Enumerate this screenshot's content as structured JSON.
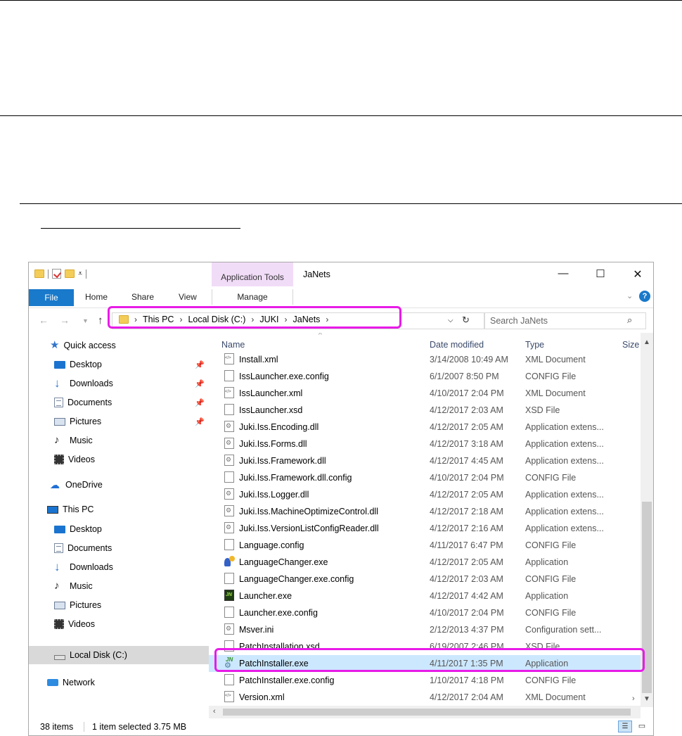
{
  "window": {
    "title": "JaNets",
    "context_tab": "Application Tools",
    "controls": {
      "minimize": "—",
      "maximize": "☐",
      "close": "✕"
    }
  },
  "ribbon": {
    "tabs": [
      "File",
      "Home",
      "Share",
      "View",
      "Manage"
    ],
    "collapse_glyph": "⌄",
    "help_glyph": "?"
  },
  "address": {
    "crumbs": [
      "This PC",
      "Local Disk (C:)",
      "JUKI",
      "JaNets"
    ],
    "separator": "›",
    "search_placeholder": "Search JaNets"
  },
  "navigation": {
    "quick_access": "Quick access",
    "quick_items": [
      "Desktop",
      "Downloads",
      "Documents",
      "Pictures",
      "Music",
      "Videos"
    ],
    "onedrive": "OneDrive",
    "this_pc": "This PC",
    "pc_items": [
      "Desktop",
      "Documents",
      "Downloads",
      "Music",
      "Pictures",
      "Videos",
      "Local Disk (C:)"
    ],
    "network": "Network"
  },
  "columns": {
    "name": "Name",
    "date": "Date modified",
    "type": "Type",
    "size": "Size"
  },
  "files": [
    {
      "name": "Install.xml",
      "date": "3/14/2008 10:49 AM",
      "type": "XML Document"
    },
    {
      "name": "IssLauncher.exe.config",
      "date": "6/1/2007 8:50 PM",
      "type": "CONFIG File"
    },
    {
      "name": "IssLauncher.xml",
      "date": "4/10/2017 2:04 PM",
      "type": "XML Document"
    },
    {
      "name": "IssLauncher.xsd",
      "date": "4/12/2017 2:03 AM",
      "type": "XSD File"
    },
    {
      "name": "Juki.Iss.Encoding.dll",
      "date": "4/12/2017 2:05 AM",
      "type": "Application extens..."
    },
    {
      "name": "Juki.Iss.Forms.dll",
      "date": "4/12/2017 3:18 AM",
      "type": "Application extens..."
    },
    {
      "name": "Juki.Iss.Framework.dll",
      "date": "4/12/2017 4:45 AM",
      "type": "Application extens..."
    },
    {
      "name": "Juki.Iss.Framework.dll.config",
      "date": "4/10/2017 2:04 PM",
      "type": "CONFIG File"
    },
    {
      "name": "Juki.Iss.Logger.dll",
      "date": "4/12/2017 2:05 AM",
      "type": "Application extens..."
    },
    {
      "name": "Juki.Iss.MachineOptimizeControl.dll",
      "date": "4/12/2017 2:18 AM",
      "type": "Application extens..."
    },
    {
      "name": "Juki.Iss.VersionListConfigReader.dll",
      "date": "4/12/2017 2:16 AM",
      "type": "Application extens..."
    },
    {
      "name": "Language.config",
      "date": "4/11/2017 6:47 PM",
      "type": "CONFIG File"
    },
    {
      "name": "LanguageChanger.exe",
      "date": "4/12/2017 2:05 AM",
      "type": "Application"
    },
    {
      "name": "LanguageChanger.exe.config",
      "date": "4/12/2017 2:03 AM",
      "type": "CONFIG File"
    },
    {
      "name": "Launcher.exe",
      "date": "4/12/2017 4:42 AM",
      "type": "Application"
    },
    {
      "name": "Launcher.exe.config",
      "date": "4/10/2017 2:04 PM",
      "type": "CONFIG File"
    },
    {
      "name": "Msver.ini",
      "date": "2/12/2013 4:37 PM",
      "type": "Configuration sett..."
    },
    {
      "name": "PatchInstallation.xsd",
      "date": "6/19/2007 2:46 PM",
      "type": "XSD File"
    },
    {
      "name": "PatchInstaller.exe",
      "date": "4/11/2017 1:35 PM",
      "type": "Application"
    },
    {
      "name": "PatchInstaller.exe.config",
      "date": "1/10/2017 4:18 PM",
      "type": "CONFIG File"
    },
    {
      "name": "Version.xml",
      "date": "4/12/2017 2:04 AM",
      "type": "XML Document"
    }
  ],
  "status": {
    "count": "38 items",
    "selection": "1 item selected  3.75 MB"
  },
  "colors": {
    "highlight": "#e81be8",
    "selected_row": "#cce8ff",
    "file_tab": "#1979ca",
    "context_tab": "#f1dcf8"
  }
}
